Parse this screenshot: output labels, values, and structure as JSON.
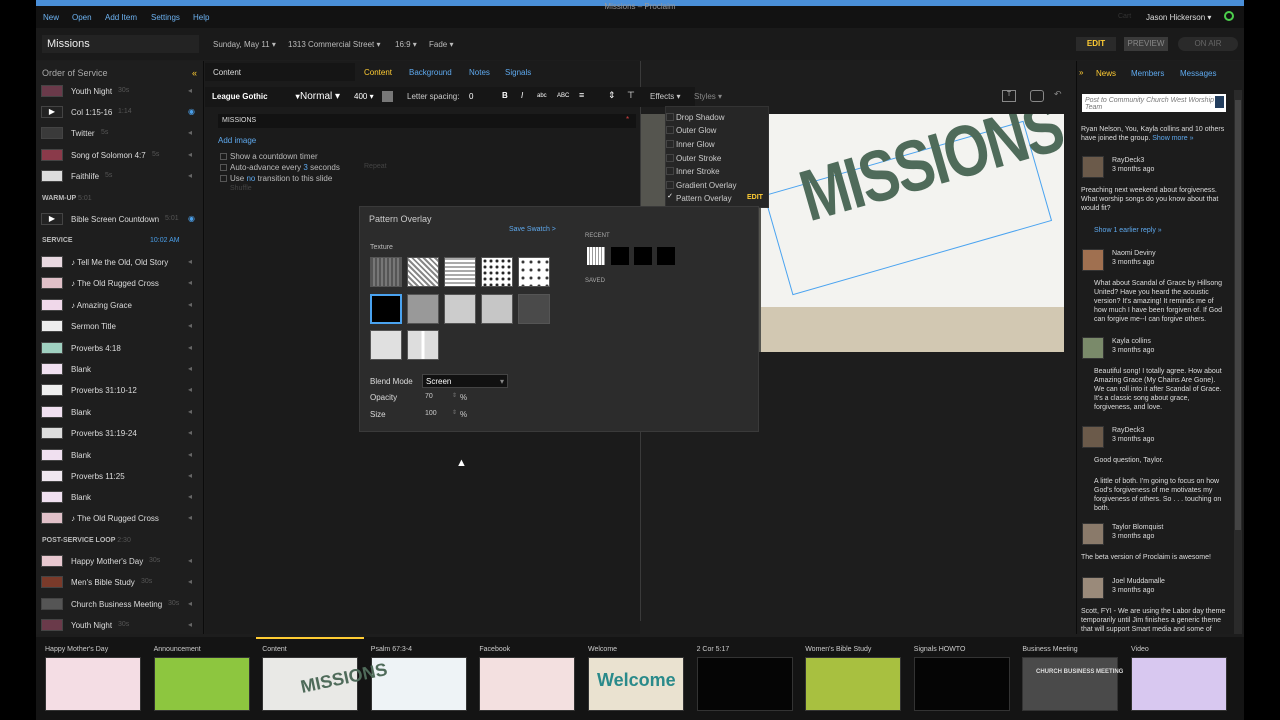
{
  "window_title": "Missions – Proclaim",
  "menu": [
    "New",
    "Open",
    "Add Item",
    "Settings",
    "Help"
  ],
  "user": {
    "name": "Jason Hickerson",
    "prefix": "Cart"
  },
  "header": {
    "service_name": "Missions",
    "date": "Sunday, May 11",
    "location": "1313 Commercial Street",
    "aspect": "16:9",
    "transition": "Fade",
    "edit": "EDIT",
    "preview": "PREVIEW",
    "on_air": "ON AIR"
  },
  "left": {
    "title": "Order of Service",
    "rows": [
      {
        "label": "Youth Night",
        "dur": "30s",
        "color": "#6a3a4a"
      },
      {
        "label": "Col 1:15-16",
        "dur": "1:14",
        "color": "#222",
        "play": true
      },
      {
        "label": "Twitter",
        "dur": "5s",
        "color": "#3a3a3a"
      },
      {
        "label": "Song of Solomon 4:7",
        "dur": "5s",
        "color": "#8a3a4a"
      },
      {
        "label": "Faithlife",
        "dur": "5s",
        "color": "#ddd"
      },
      {
        "label": "Bible Screen Countdown",
        "dur": "5:01",
        "color": "#222",
        "play": true
      },
      {
        "label": "♪ Tell Me the Old, Old Story",
        "dur": "",
        "color": "#e8d8e0"
      },
      {
        "label": "♪ The Old Rugged Cross",
        "dur": "",
        "color": "#e0c0c8"
      },
      {
        "label": "♪ Amazing Grace",
        "dur": "",
        "color": "#f0d8ea"
      },
      {
        "label": "Sermon Title",
        "dur": "",
        "color": "#eee"
      },
      {
        "label": "Proverbs 4:18",
        "dur": "",
        "color": "#9fd0c0"
      },
      {
        "label": "Blank",
        "dur": "",
        "color": "#f0e0f0"
      },
      {
        "label": "Proverbs 31:10-12",
        "dur": "",
        "color": "#eee"
      },
      {
        "label": "Blank",
        "dur": "",
        "color": "#f0e0f0"
      },
      {
        "label": "Proverbs 31:19-24",
        "dur": "",
        "color": "#ddd"
      },
      {
        "label": "Blank",
        "dur": "",
        "color": "#f0e0f0"
      },
      {
        "label": "Proverbs 11:25",
        "dur": "",
        "color": "#f0e8f0"
      },
      {
        "label": "Blank",
        "dur": "",
        "color": "#f0e0f0"
      },
      {
        "label": "♪ The Old Rugged Cross",
        "dur": "",
        "color": "#e0c0c8"
      },
      {
        "label": "Happy Mother's Day",
        "dur": "30s",
        "color": "#e8c8d0"
      },
      {
        "label": "Men's Bible Study",
        "dur": "30s",
        "color": "#7a3a2a"
      },
      {
        "label": "Church Business Meeting",
        "dur": "30s",
        "color": "#555"
      },
      {
        "label": "Youth Night",
        "dur": "30s",
        "color": "#6a3a4a"
      }
    ],
    "sections": {
      "warmup": "WARM-UP",
      "warmup_time": "5:01",
      "service": "SERVICE",
      "service_time": "10:02 AM",
      "post": "POST-SERVICE LOOP",
      "post_time": "2:30"
    }
  },
  "tabs": {
    "content_label": "Content",
    "items": [
      "Content",
      "Background",
      "Notes",
      "Signals"
    ]
  },
  "format": {
    "font": "League Gothic",
    "style": "Normal",
    "weight": "400",
    "letter_spacing_label": "Letter spacing:",
    "letter_spacing": "0",
    "effects": "Effects",
    "styles": "Styles"
  },
  "slide": {
    "name": "MISSIONS",
    "add_image": "Add image",
    "countdown": "Show a countdown timer",
    "auto_advance_pre": "Auto-advance every",
    "auto_advance_n": "3",
    "auto_advance_post": "seconds",
    "use": "Use",
    "no": "no",
    "transition": "transition to this slide",
    "repeat": "Repeat",
    "shuffle": "Shuffle"
  },
  "effects_menu": [
    "Drop Shadow",
    "Outer Glow",
    "Inner Glow",
    "Outer Stroke",
    "Inner Stroke",
    "Gradient Overlay",
    "Pattern Overlay"
  ],
  "effects_edit": "EDIT",
  "pattern": {
    "title": "Pattern Overlay",
    "save": "Save Swatch >",
    "texture": "Texture",
    "recent": "RECENT",
    "saved": "SAVED",
    "blend_label": "Blend Mode",
    "blend": "Screen",
    "opacity_label": "Opacity",
    "opacity": "70",
    "size_label": "Size",
    "size": "100",
    "pct": "%"
  },
  "preview_text": "MISSIONS",
  "right": {
    "tabs": [
      "News",
      "Members",
      "Messages"
    ],
    "post_placeholder": "Post to Community Church West Worship Team",
    "joined": "Ryan Nelson, You, Kayla collins and 10 others have joined the group.",
    "show_more": "Show more »",
    "posts": [
      {
        "name": "RayDeck3",
        "time": "3 months ago",
        "text": "Preaching next weekend about forgiveness. What worship songs do you know about that would fit?"
      },
      {
        "name": "Naomi Deviny",
        "time": "3 months ago",
        "text": "What about Scandal of Grace by Hillsong United? Have you heard the acoustic version? It's amazing! It reminds me of how much I have been forgiven of. If God can forgive me--I can forgive others."
      },
      {
        "name": "Kayla collins",
        "time": "3 months ago",
        "text": "Beautiful song! I totally agree. How about Amazing Grace (My Chains Are Gone). We can roll into it after Scandal of Grace. It's a classic song about grace, forgiveness, and love."
      },
      {
        "name": "RayDeck3",
        "time": "3 months ago",
        "text": "Good question, Taylor."
      },
      {
        "name": "",
        "time": "",
        "text": "A little of both. I'm going to focus on how God's forgiveness of me motivates my forgiveness of others. So . . . touching on both."
      },
      {
        "name": "Taylor Blomquist",
        "time": "3 months ago",
        "text": "The beta version of Proclaim is awesome!"
      },
      {
        "name": "Joel Muddamalle",
        "time": "3 months ago",
        "text": "Scott, FYI - We are using the Labor day theme temporarily until Jim finishes a generic theme that will support Smart media and some of"
      }
    ],
    "earlier": "Show 1 earlier reply »"
  },
  "tray": [
    {
      "label": "Happy Mother's Day",
      "bg": "#f4dde4"
    },
    {
      "label": "Announcement",
      "bg": "#8dc63f"
    },
    {
      "label": "Content",
      "bg": "#e9e9e6"
    },
    {
      "label": "Psalm 67:3-4",
      "bg": "#eef3f6"
    },
    {
      "label": "Facebook",
      "bg": "#f3e0e0"
    },
    {
      "label": "Welcome",
      "bg": "#eae2d0"
    },
    {
      "label": "2 Cor 5:17",
      "bg": "#050505"
    },
    {
      "label": "Women's Bible Study",
      "bg": "#a8c040"
    },
    {
      "label": "Signals HOWTO",
      "bg": "#050505"
    },
    {
      "label": "Business Meeting",
      "bg": "#4a4a4a"
    },
    {
      "label": "Video",
      "bg": "#d8c8f0"
    }
  ],
  "tray_texts": {
    "missions": "MISSIONS",
    "welcome": "Welcome",
    "business": "CHURCH BUSINESS MEETING"
  }
}
